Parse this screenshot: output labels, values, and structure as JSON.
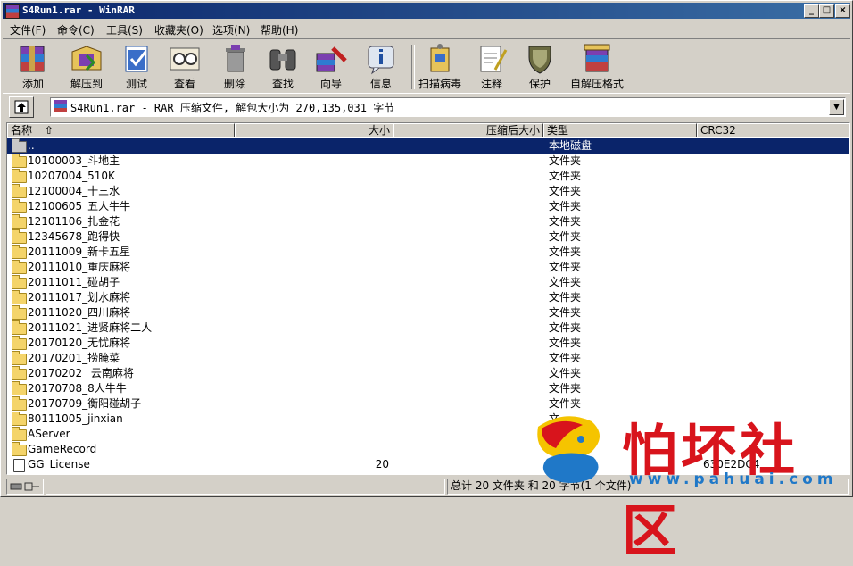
{
  "window": {
    "title": "S4Run1.rar - WinRAR",
    "controls": {
      "minimize": "_",
      "maximize": "□",
      "close": "×"
    }
  },
  "menu": [
    "文件(F)",
    "命令(C)",
    "工具(S)",
    "收藏夹(O)",
    "选项(N)",
    "帮助(H)"
  ],
  "toolbar": [
    {
      "label": "添加",
      "icon": "add-icon"
    },
    {
      "label": "解压到",
      "icon": "extract-to-icon"
    },
    {
      "label": "测试",
      "icon": "test-icon"
    },
    {
      "label": "查看",
      "icon": "view-icon"
    },
    {
      "label": "删除",
      "icon": "delete-icon"
    },
    {
      "label": "查找",
      "icon": "find-icon"
    },
    {
      "label": "向导",
      "icon": "wizard-icon"
    },
    {
      "label": "信息",
      "icon": "info-icon"
    },
    {
      "label": "扫描病毒",
      "icon": "virus-scan-icon"
    },
    {
      "label": "注释",
      "icon": "comment-icon"
    },
    {
      "label": "保护",
      "icon": "protect-icon"
    },
    {
      "label": "自解压格式",
      "icon": "sfx-icon"
    }
  ],
  "address": {
    "text": "S4Run1.rar - RAR 压缩文件, 解包大小为 270,135,031 字节",
    "dropdown": "▼"
  },
  "columns": {
    "name": "名称",
    "sort_indicator": "⇧",
    "size": "大小",
    "packed": "压缩后大小",
    "type": "类型",
    "crc": "CRC32"
  },
  "files": [
    {
      "name": "..",
      "size": "",
      "type": "本地磁盘",
      "crc": "",
      "kind": "up",
      "selected": true
    },
    {
      "name": "10100003_斗地主",
      "size": "",
      "type": "文件夹",
      "crc": "",
      "kind": "folder"
    },
    {
      "name": "10207004_510K",
      "size": "",
      "type": "文件夹",
      "crc": "",
      "kind": "folder"
    },
    {
      "name": "12100004_十三水",
      "size": "",
      "type": "文件夹",
      "crc": "",
      "kind": "folder"
    },
    {
      "name": "12100605_五人牛牛",
      "size": "",
      "type": "文件夹",
      "crc": "",
      "kind": "folder"
    },
    {
      "name": "12101106_扎金花",
      "size": "",
      "type": "文件夹",
      "crc": "",
      "kind": "folder"
    },
    {
      "name": "12345678_跑得快",
      "size": "",
      "type": "文件夹",
      "crc": "",
      "kind": "folder"
    },
    {
      "name": "20111009_新卡五星",
      "size": "",
      "type": "文件夹",
      "crc": "",
      "kind": "folder"
    },
    {
      "name": "20111010_重庆麻将",
      "size": "",
      "type": "文件夹",
      "crc": "",
      "kind": "folder"
    },
    {
      "name": "20111011_碰胡子",
      "size": "",
      "type": "文件夹",
      "crc": "",
      "kind": "folder"
    },
    {
      "name": "20111017_划水麻将",
      "size": "",
      "type": "文件夹",
      "crc": "",
      "kind": "folder"
    },
    {
      "name": "20111020_四川麻将",
      "size": "",
      "type": "文件夹",
      "crc": "",
      "kind": "folder"
    },
    {
      "name": "20111021_进贤麻将二人",
      "size": "",
      "type": "文件夹",
      "crc": "",
      "kind": "folder"
    },
    {
      "name": "20170120_无忧麻将",
      "size": "",
      "type": "文件夹",
      "crc": "",
      "kind": "folder"
    },
    {
      "name": "20170201_捞腌菜",
      "size": "",
      "type": "文件夹",
      "crc": "",
      "kind": "folder"
    },
    {
      "name": "20170202 _云南麻将",
      "size": "",
      "type": "文件夹",
      "crc": "",
      "kind": "folder"
    },
    {
      "name": "20170708_8人牛牛",
      "size": "",
      "type": "文件夹",
      "crc": "",
      "kind": "folder"
    },
    {
      "name": "20170709_衡阳碰胡子",
      "size": "",
      "type": "文件夹",
      "crc": "",
      "kind": "folder"
    },
    {
      "name": "80111005_jinxian",
      "size": "",
      "type": "文",
      "crc": "",
      "kind": "folder"
    },
    {
      "name": "AServer",
      "size": "",
      "type": "",
      "crc": "",
      "kind": "folder"
    },
    {
      "name": "GameRecord",
      "size": "",
      "type": "",
      "crc": "",
      "kind": "folder"
    },
    {
      "name": "GG_License",
      "size": "20",
      "type": "",
      "crc": "630E2DC4",
      "kind": "file"
    }
  ],
  "status": {
    "text": "总计 20 文件夹 和 20 字节(1 个文件)"
  },
  "watermark": {
    "text": "怕坏社区",
    "url": "www.pahuai.com"
  }
}
